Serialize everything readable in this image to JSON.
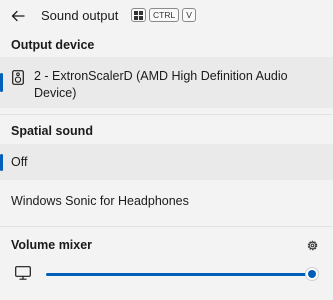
{
  "header": {
    "back_icon": "arrow-left-icon",
    "title": "Sound output",
    "shortcut": {
      "win_icon": "windows-key-icon",
      "keys": [
        "CTRL",
        "V"
      ]
    }
  },
  "output_device": {
    "heading": "Output device",
    "icon": "speaker-icon",
    "selected_device": "2 - ExtronScalerD (AMD High Definition Audio Device)"
  },
  "spatial_sound": {
    "heading": "Spatial sound",
    "options": [
      {
        "label": "Off",
        "selected": true
      },
      {
        "label": "Windows Sonic for Headphones",
        "selected": false
      }
    ]
  },
  "volume_mixer": {
    "heading": "Volume mixer",
    "settings_icon": "gear-icon",
    "device_icon": "monitor-icon",
    "volume_fraction": 1.0
  },
  "colors": {
    "accent": "#005fb8",
    "background": "#f3f3f3",
    "selected_row": "#eaeaea"
  }
}
